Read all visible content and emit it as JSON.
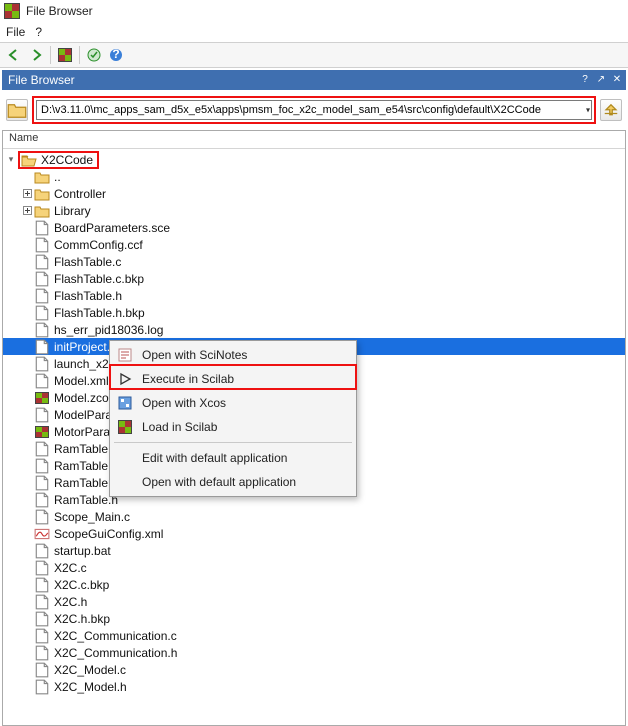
{
  "window": {
    "title": "File Browser"
  },
  "menu": {
    "file": "File",
    "help": "?"
  },
  "dock": {
    "title": "File Browser"
  },
  "path": {
    "value": "D:\\v3.11.0\\mc_apps_sam_d5x_e5x\\apps\\pmsm_foc_x2c_model_sam_e54\\src\\config\\default\\X2CCode"
  },
  "tree": {
    "header": "Name",
    "root": "X2CCode",
    "items": [
      {
        "label": "..",
        "kind": "folder",
        "twist": ""
      },
      {
        "label": "Controller",
        "kind": "folder",
        "twist": "plus"
      },
      {
        "label": "Library",
        "kind": "folder",
        "twist": "plus"
      },
      {
        "label": "BoardParameters.sce",
        "kind": "file"
      },
      {
        "label": "CommConfig.ccf",
        "kind": "file"
      },
      {
        "label": "FlashTable.c",
        "kind": "file"
      },
      {
        "label": "FlashTable.c.bkp",
        "kind": "file"
      },
      {
        "label": "FlashTable.h",
        "kind": "file"
      },
      {
        "label": "FlashTable.h.bkp",
        "kind": "file"
      },
      {
        "label": "hs_err_pid18036.log",
        "kind": "file"
      },
      {
        "label": "initProject.sce",
        "kind": "file",
        "selected": true
      },
      {
        "label": "launch_x2c",
        "kind": "file"
      },
      {
        "label": "Model.xml",
        "kind": "file"
      },
      {
        "label": "Model.zcos",
        "kind": "zcos"
      },
      {
        "label": "ModelParam",
        "kind": "file"
      },
      {
        "label": "MotorParam",
        "kind": "zcos"
      },
      {
        "label": "RamTable.c",
        "kind": "file"
      },
      {
        "label": "RamTable.c",
        "kind": "file"
      },
      {
        "label": "RamTable.h",
        "kind": "file"
      },
      {
        "label": "RamTable.h",
        "kind": "file"
      },
      {
        "label": "Scope_Main.c",
        "kind": "file"
      },
      {
        "label": "ScopeGuiConfig.xml",
        "kind": "scope"
      },
      {
        "label": "startup.bat",
        "kind": "file"
      },
      {
        "label": "X2C.c",
        "kind": "file"
      },
      {
        "label": "X2C.c.bkp",
        "kind": "file"
      },
      {
        "label": "X2C.h",
        "kind": "file"
      },
      {
        "label": "X2C.h.bkp",
        "kind": "file"
      },
      {
        "label": "X2C_Communication.c",
        "kind": "file"
      },
      {
        "label": "X2C_Communication.h",
        "kind": "file"
      },
      {
        "label": "X2C_Model.c",
        "kind": "file"
      },
      {
        "label": "X2C_Model.h",
        "kind": "file"
      }
    ]
  },
  "context_menu": {
    "items": [
      {
        "label": "Open with SciNotes",
        "icon": "notes"
      },
      {
        "label": "Execute in Scilab",
        "icon": "play"
      },
      {
        "label": "Open with Xcos",
        "icon": "xcos"
      },
      {
        "label": "Load in Scilab",
        "icon": "scilab"
      }
    ],
    "extra": [
      {
        "label": "Edit with default application"
      },
      {
        "label": "Open with default application"
      }
    ]
  }
}
